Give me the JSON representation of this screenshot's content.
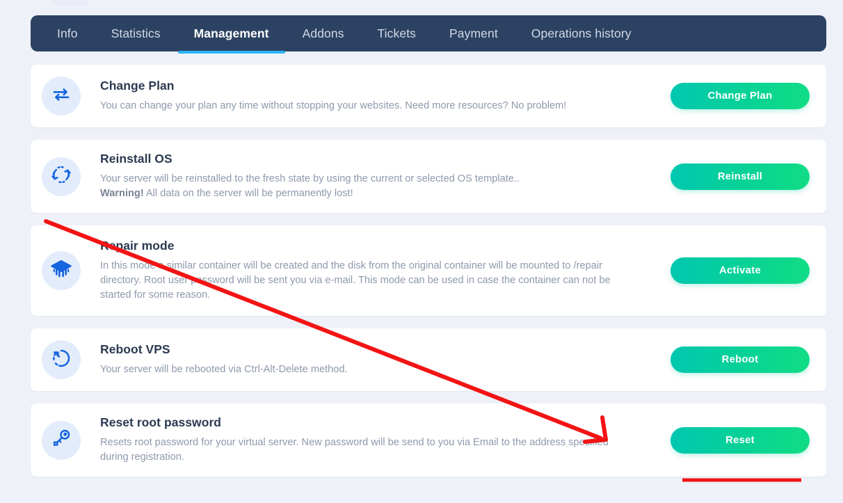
{
  "tabs": [
    {
      "label": "Info",
      "active": false
    },
    {
      "label": "Statistics",
      "active": false
    },
    {
      "label": "Management",
      "active": true
    },
    {
      "label": "Addons",
      "active": false
    },
    {
      "label": "Tickets",
      "active": false
    },
    {
      "label": "Payment",
      "active": false
    },
    {
      "label": "Operations history",
      "active": false
    }
  ],
  "cards": [
    {
      "icon": "exchange-arrows-icon",
      "title": "Change Plan",
      "desc": "You can change your plan any time without stopping your websites. Need more resources? No problem!",
      "warning": "",
      "warning_rest": "",
      "button": "Change Plan"
    },
    {
      "icon": "refresh-dashed-circle-icon",
      "title": "Reinstall OS",
      "desc": "Your server will be reinstalled to the fresh state by using the current or selected OS template..",
      "warning": "Warning!",
      "warning_rest": " All data on the server will be permanently lost!",
      "button": "Reinstall"
    },
    {
      "icon": "layers-stack-icon",
      "title": "Repair mode",
      "desc": "In this mode a similar container will be created and the disk from the original container will be mounted to /repair directory. Root user password will be sent you via e-mail. This mode can be used in case the container can not be started for some reason.",
      "warning": "",
      "warning_rest": "",
      "button": "Activate"
    },
    {
      "icon": "reboot-arrow-circle-icon",
      "title": "Reboot VPS",
      "desc": "Your server will be rebooted via Ctrl-Alt-Delete method.",
      "warning": "",
      "warning_rest": "",
      "button": "Reboot"
    },
    {
      "icon": "key-icon",
      "title": "Reset root password",
      "desc": "Resets root password for your virtual server. New password will be send to you via Email to the address specified during registration.",
      "warning": "",
      "warning_rest": "",
      "button": "Reset"
    }
  ],
  "colors": {
    "page_background": "#eef1f8",
    "tabbar_background": "#2c4263",
    "tab_active_underline": "#29b6f6",
    "button_gradient_start": "#00c7b0",
    "button_gradient_end": "#12dd84",
    "icon_circle_background": "#e3ecfb",
    "icon_blue": "#1565e0",
    "annotation_red": "#f01010",
    "title_text": "#2b3a51",
    "body_text": "#8e99ad"
  },
  "annotations": {
    "arrow_label": "red-arrow-pointing-to-reset-button",
    "underline_label": "red-underline-under-reset-button"
  }
}
